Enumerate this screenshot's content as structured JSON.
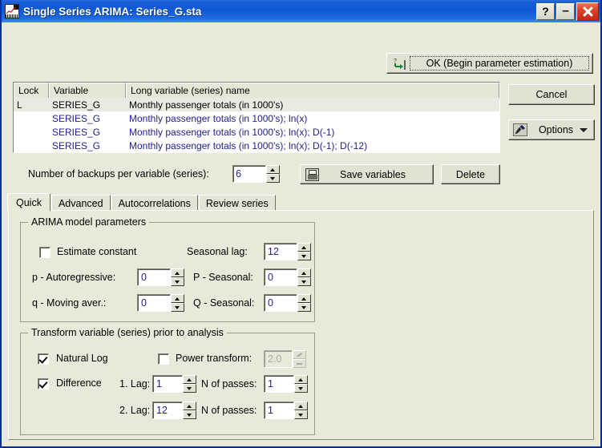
{
  "window": {
    "title": "Single Series ARIMA: Series_G.sta",
    "icon": "chart-icon",
    "buttons": {
      "help": "?",
      "minimize": "–",
      "close": "×"
    }
  },
  "ok_button": {
    "label": "OK (Begin parameter estimation)",
    "icon": "run-arrow-icon"
  },
  "side_buttons": {
    "cancel": "Cancel",
    "options": "Options",
    "options_icon": "tool-icon",
    "options_chevron": "chevron-down-icon"
  },
  "variable_list": {
    "columns": [
      "Lock",
      "Variable",
      "Long variable (series) name"
    ],
    "rows": [
      {
        "lock": "L",
        "variable": "SERIES_G",
        "name": "Monthly passenger totals (in 1000's)",
        "selected": true,
        "color": "black"
      },
      {
        "lock": "",
        "variable": "SERIES_G",
        "name": "Monthly passenger totals (in 1000's); ln(x)",
        "selected": false,
        "color": "blue"
      },
      {
        "lock": "",
        "variable": "SERIES_G",
        "name": "Monthly passenger totals (in 1000's); ln(x); D(-1)",
        "selected": false,
        "color": "blue"
      },
      {
        "lock": "",
        "variable": "SERIES_G",
        "name": "Monthly passenger totals (in 1000's); ln(x); D(-1); D(-12)",
        "selected": false,
        "color": "blue"
      }
    ]
  },
  "backups": {
    "label": "Number of backups per variable (series):",
    "value": "6"
  },
  "actions": {
    "save_variables": "Save variables",
    "save_variables_accel": "a",
    "save_icon": "floppy-disk-icon",
    "delete": "Delete"
  },
  "tabs": [
    {
      "label": "Quick",
      "active": true
    },
    {
      "label": "Advanced",
      "active": false
    },
    {
      "label": "Autocorrelations",
      "active": false
    },
    {
      "label": "Review series",
      "active": false
    }
  ],
  "arima_group": {
    "title": "ARIMA model parameters",
    "estimate_constant": {
      "label": "Estimate constant",
      "checked": false
    },
    "seasonal_lag": {
      "label": "Seasonal lag:",
      "value": "12"
    },
    "p_autoregressive": {
      "label": "p - Autoregressive:",
      "value": "0"
    },
    "p_seasonal": {
      "label": "P - Seasonal:",
      "value": "0"
    },
    "q_moving_aver": {
      "label": "q - Moving aver.:",
      "value": "0"
    },
    "q_seasonal": {
      "label": "Q - Seasonal:",
      "value": "0"
    }
  },
  "transform_group": {
    "title": "Transform variable (series) prior to analysis",
    "natural_log": {
      "label": "Natural Log",
      "checked": true
    },
    "power_transform": {
      "label": "Power transform:",
      "checked": false,
      "value": "2.0",
      "disabled": true
    },
    "difference": {
      "label": "Difference",
      "checked": true
    },
    "lag1": {
      "label": "1. Lag:",
      "value": "1"
    },
    "lag1_passes": {
      "label": "N of passes:",
      "value": "1"
    },
    "lag2": {
      "label": "2. Lag:",
      "value": "12"
    },
    "lag2_passes": {
      "label": "N of passes:",
      "value": "1"
    }
  },
  "colors": {
    "titlebar": "#1158D4",
    "dialog_bg": "#E9E9DA",
    "field_value": "#202090",
    "close_button": "#C4261A"
  }
}
